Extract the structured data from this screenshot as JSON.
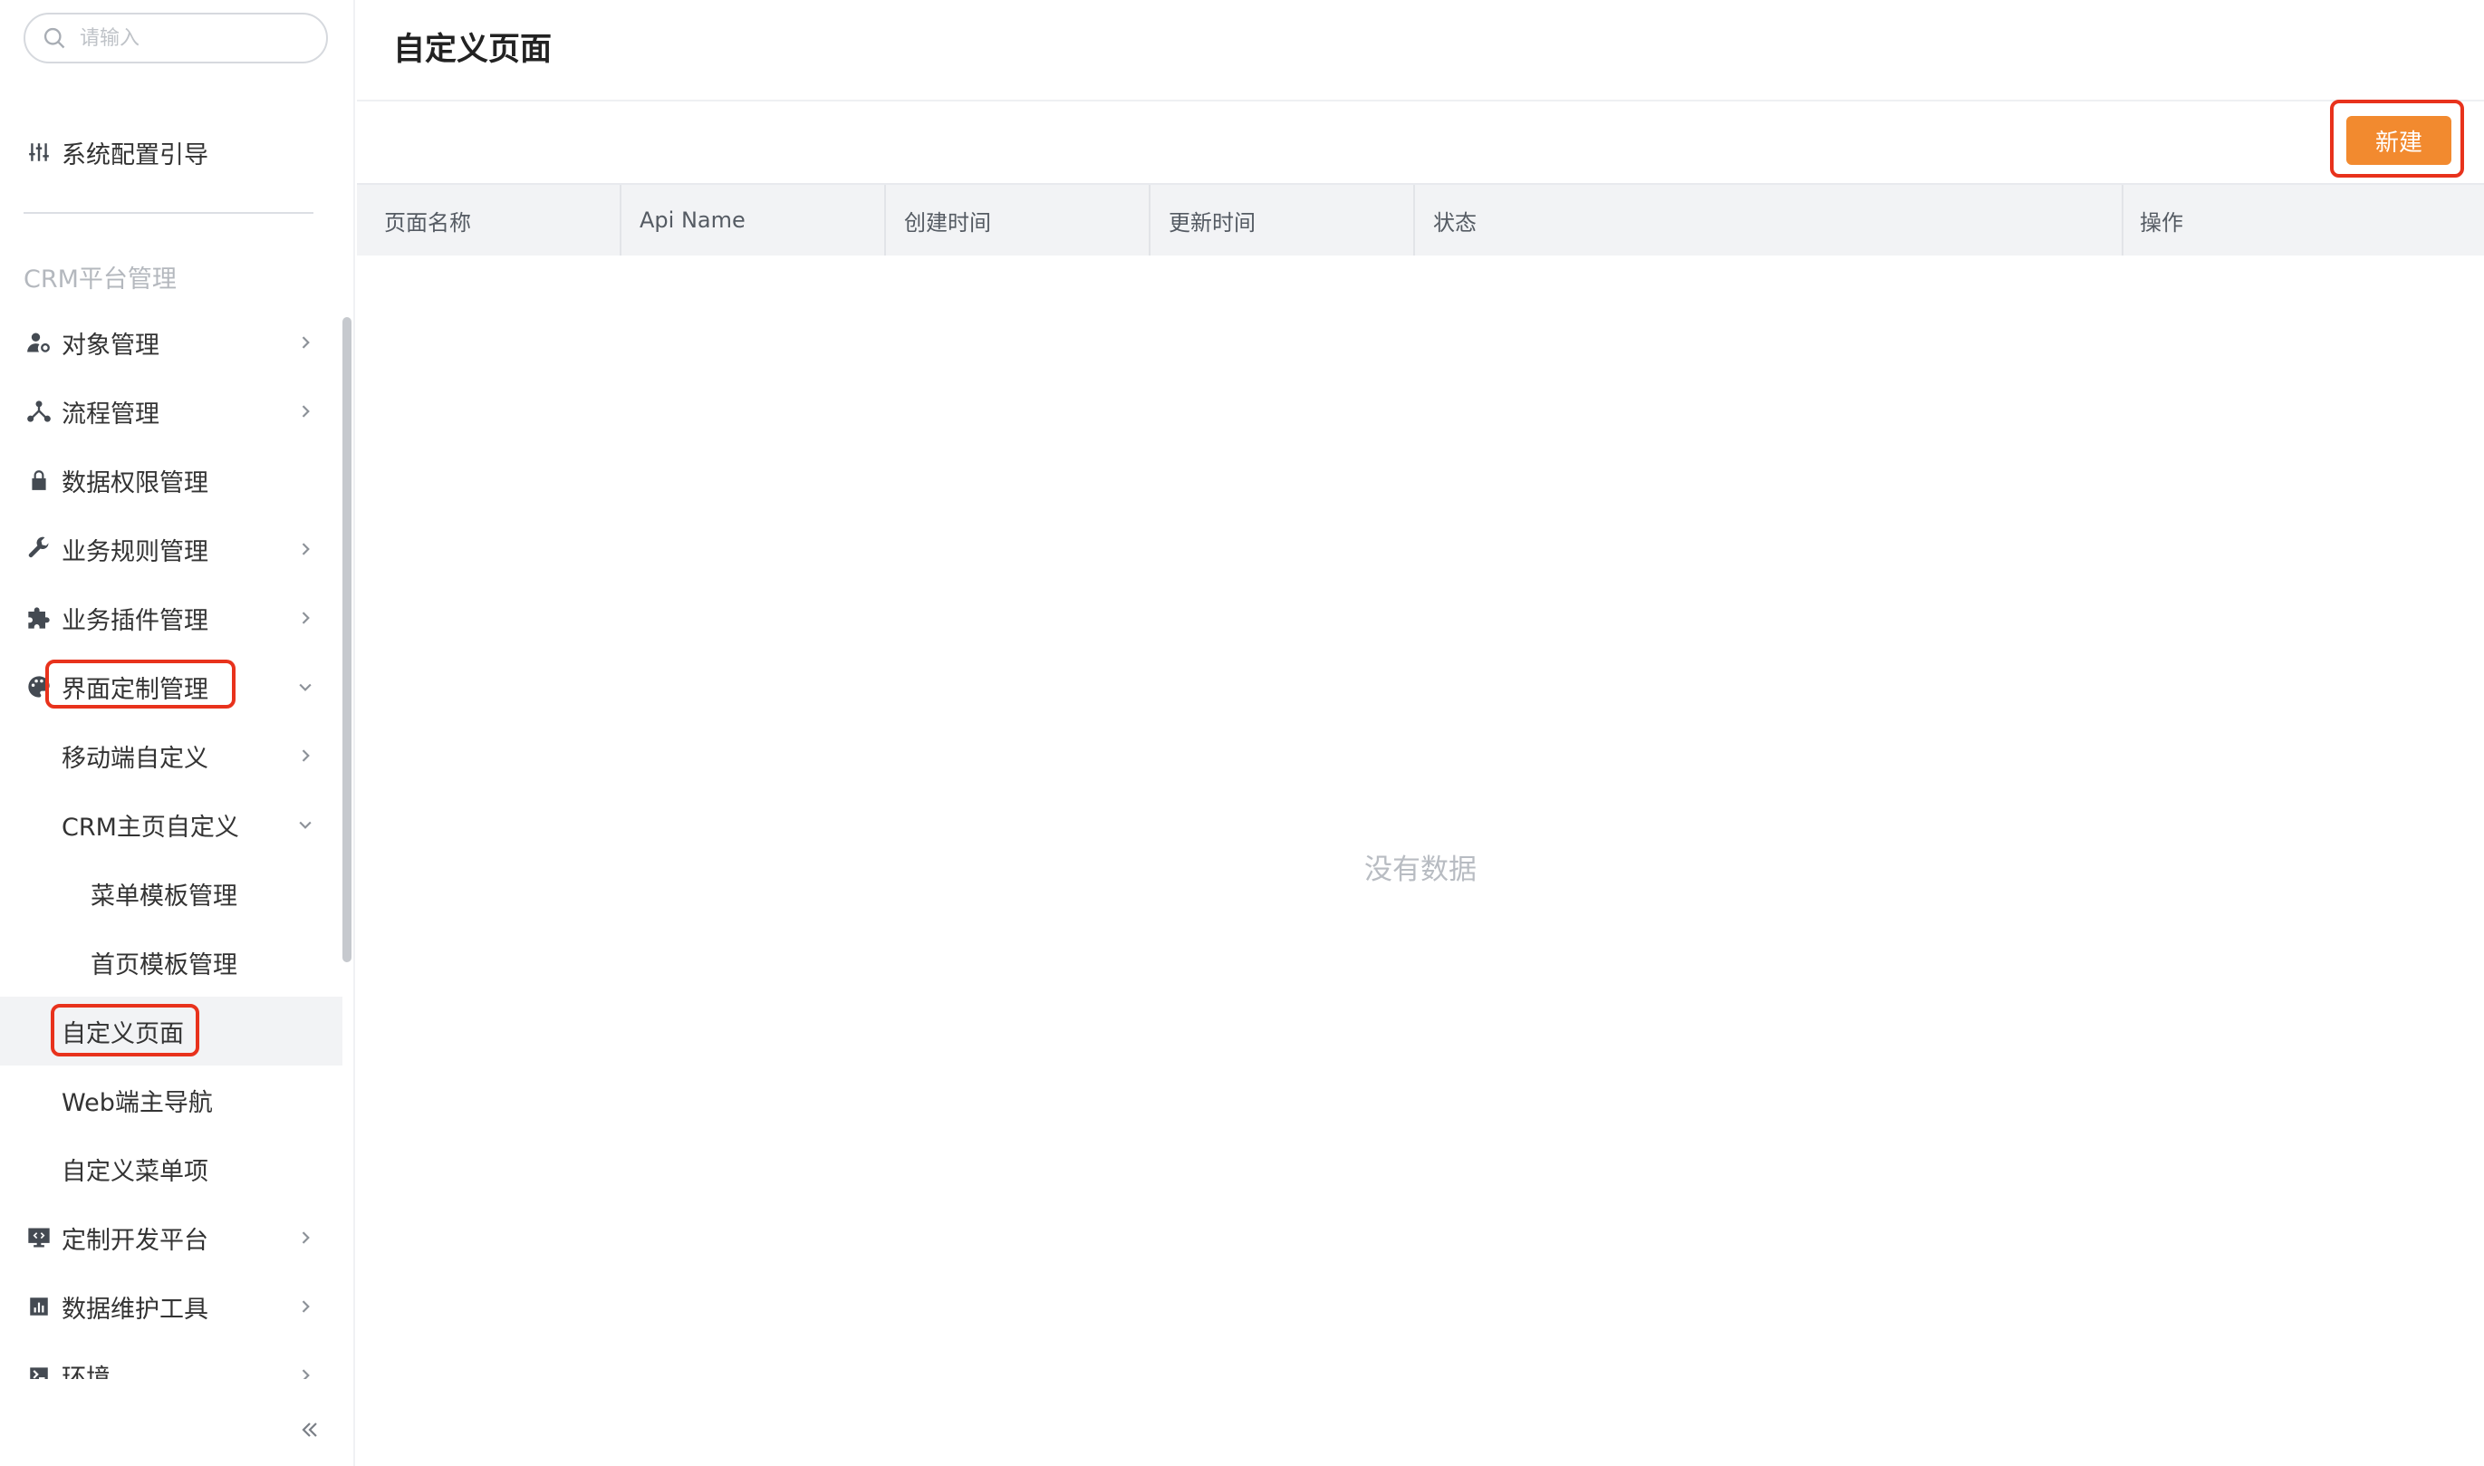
{
  "search": {
    "placeholder": "请输入"
  },
  "sidebar": {
    "guide_label": "系统配置引导",
    "section_title": "CRM平台管理",
    "items": [
      {
        "label": "对象管理",
        "icon": "user-settings-icon",
        "arrow": "right"
      },
      {
        "label": "流程管理",
        "icon": "flow-icon",
        "arrow": "right"
      },
      {
        "label": "数据权限管理",
        "icon": "lock-icon",
        "arrow": "none"
      },
      {
        "label": "业务规则管理",
        "icon": "wrench-icon",
        "arrow": "right"
      },
      {
        "label": "业务插件管理",
        "icon": "puzzle-icon",
        "arrow": "right"
      },
      {
        "label": "界面定制管理",
        "icon": "palette-icon",
        "arrow": "down"
      },
      {
        "label": "移动端自定义",
        "arrow": "right"
      },
      {
        "label": "CRM主页自定义",
        "arrow": "down"
      },
      {
        "label": "菜单模板管理",
        "arrow": "none"
      },
      {
        "label": "首页模板管理",
        "arrow": "none"
      },
      {
        "label": "自定义页面",
        "arrow": "none",
        "active": true
      },
      {
        "label": "Web端主导航",
        "arrow": "none"
      },
      {
        "label": "自定义菜单项",
        "arrow": "none"
      },
      {
        "label": "定制开发平台",
        "icon": "monitor-code-icon",
        "arrow": "right"
      },
      {
        "label": "数据维护工具",
        "icon": "chart-box-icon",
        "arrow": "right"
      },
      {
        "label": "环境",
        "icon": "env-icon",
        "arrow": "right"
      }
    ]
  },
  "main": {
    "title": "自定义页面",
    "new_button": "新建",
    "columns": [
      "页面名称",
      "Api Name",
      "创建时间",
      "更新时间",
      "状态",
      "操作"
    ],
    "empty_text": "没有数据"
  },
  "colors": {
    "accent": "#f28a2f",
    "highlight": "#e8321c",
    "active_bg": "#f2f3f5"
  }
}
